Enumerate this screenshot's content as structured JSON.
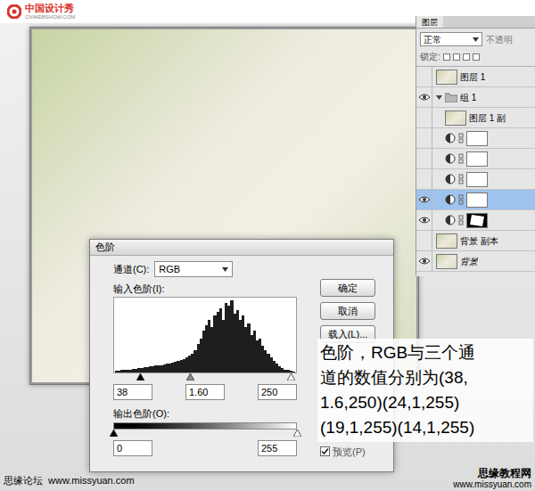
{
  "logo": {
    "name": "中国设计秀",
    "url": "CNWEBSHOW.COM"
  },
  "layers_panel": {
    "tabs": [
      {
        "label": "图层",
        "selected": true
      }
    ],
    "blend_mode": "正常",
    "opacity_label": "不透明",
    "lock_label": "锁定:",
    "layers": [
      {
        "name": "图层 1",
        "kind": "pixel",
        "visible": false,
        "selected": false,
        "in_group": false
      },
      {
        "name": "组 1",
        "kind": "group",
        "visible": true,
        "selected": false,
        "in_group": false,
        "expanded": true
      },
      {
        "name": "图层 1 副",
        "kind": "pixel",
        "visible": false,
        "selected": false,
        "in_group": true
      },
      {
        "kind": "adjustment",
        "visible": false,
        "selected": false,
        "in_group": true
      },
      {
        "kind": "adjustment",
        "visible": false,
        "selected": false,
        "in_group": true
      },
      {
        "kind": "adjustment",
        "visible": false,
        "selected": false,
        "in_group": true
      },
      {
        "kind": "adjustment",
        "visible": true,
        "selected": true,
        "in_group": true
      },
      {
        "kind": "adjustment-masked",
        "visible": true,
        "selected": false,
        "in_group": true
      },
      {
        "name": "背景 副本",
        "kind": "pixel",
        "visible": false,
        "selected": false,
        "in_group": false
      },
      {
        "name": "背景",
        "kind": "background",
        "visible": true,
        "selected": false,
        "in_group": false
      }
    ]
  },
  "levels_dialog": {
    "title": "色阶",
    "channel_label": "通道(C):",
    "channel": "RGB",
    "input_label": "输入色阶(I):",
    "histogram": {
      "values": [
        2,
        2,
        3,
        3,
        4,
        4,
        5,
        5,
        6,
        6,
        7,
        7,
        8,
        8,
        9,
        10,
        10,
        11,
        12,
        12,
        13,
        14,
        15,
        16,
        18,
        20,
        22,
        25,
        30,
        38,
        45,
        55,
        62,
        70,
        60,
        75,
        80,
        85,
        70,
        92,
        88,
        95,
        78,
        82,
        70,
        75,
        60,
        65,
        50,
        55,
        42,
        45,
        35,
        30,
        25,
        20,
        15,
        12,
        8,
        6,
        4,
        3,
        2,
        1
      ]
    },
    "input_sliders": [
      {
        "kind": "black",
        "level": 0.15
      },
      {
        "kind": "gray",
        "level": 0.42
      },
      {
        "kind": "white",
        "level": 0.97
      }
    ],
    "inputs": [
      "38",
      "1.60",
      "250"
    ],
    "output_label": "输出色阶(O):",
    "output_sliders": [
      {
        "kind": "black",
        "level": 0
      },
      {
        "kind": "white",
        "level": 1
      }
    ],
    "outputs": [
      "0",
      "255"
    ],
    "buttons": [
      "确定",
      "取消",
      "载入(L)..."
    ],
    "preview": {
      "label": "预览(P)",
      "checked": true
    }
  },
  "caption": {
    "lines": [
      "色阶，RGB与三个通",
      "道的数值分别为(38,",
      "1.6,250)(24,1,255)",
      "(19,1,255)(14,1,255)"
    ]
  },
  "footer": {
    "left": "思缘论坛",
    "left_url": "www.missyuan.com",
    "right": "思缘教程网",
    "right_url": "www.missyuan.com"
  }
}
